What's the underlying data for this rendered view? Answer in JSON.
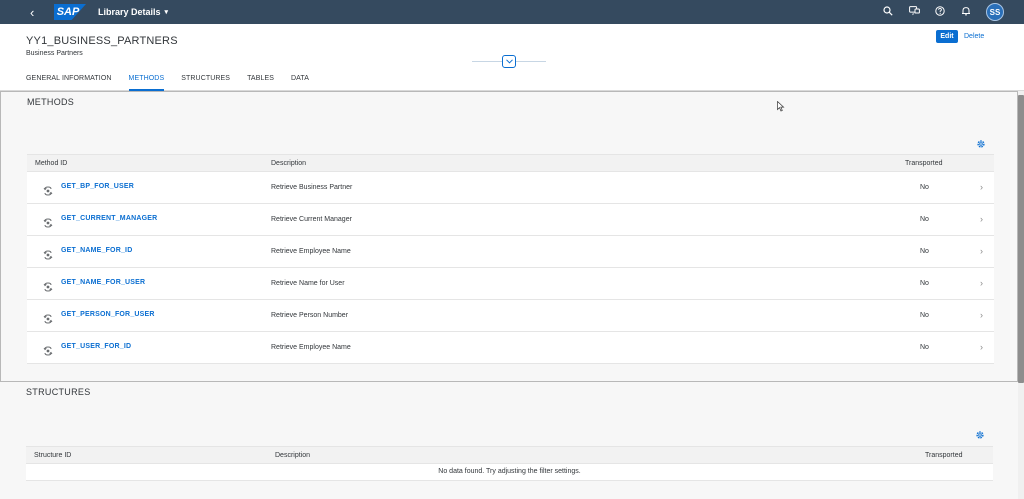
{
  "shell": {
    "back_glyph": "‹",
    "logo_text": "SAP",
    "app_title": "Library Details",
    "title_caret": "▾",
    "user_initials": "SS",
    "colors": {
      "shell_bg": "#354a5f",
      "brand": "#0a6ed1"
    },
    "icons": [
      "search-icon",
      "feedback-icon",
      "help-icon",
      "notifications-icon"
    ]
  },
  "header": {
    "title": "YY1_BUSINESS_PARTNERS",
    "subtitle": "Business Partners",
    "edit_label": "Edit",
    "delete_label": "Delete"
  },
  "tabs": [
    {
      "label": "GENERAL INFORMATION",
      "active": false
    },
    {
      "label": "METHODS",
      "active": true
    },
    {
      "label": "STRUCTURES",
      "active": false
    },
    {
      "label": "TABLES",
      "active": false
    },
    {
      "label": "DATA",
      "active": false
    }
  ],
  "methods": {
    "section_title": "METHODS",
    "columns": {
      "id": "Method ID",
      "description": "Description",
      "transported": "Transported"
    },
    "rows": [
      {
        "id": "GET_BP_FOR_USER",
        "description": "Retrieve Business Partner",
        "transported": "No"
      },
      {
        "id": "GET_CURRENT_MANAGER",
        "description": "Retrieve Current Manager",
        "transported": "No"
      },
      {
        "id": "GET_NAME_FOR_ID",
        "description": "Retrieve Employee Name",
        "transported": "No"
      },
      {
        "id": "GET_NAME_FOR_USER",
        "description": "Retrieve Name for User",
        "transported": "No"
      },
      {
        "id": "GET_PERSON_FOR_USER",
        "description": "Retrieve Person Number",
        "transported": "No"
      },
      {
        "id": "GET_USER_FOR_ID",
        "description": "Retrieve Employee Name",
        "transported": "No"
      }
    ]
  },
  "structures": {
    "section_title": "STRUCTURES",
    "columns": {
      "id": "Structure ID",
      "description": "Description",
      "transported": "Transported"
    },
    "no_data": "No data found. Try adjusting the filter settings."
  }
}
